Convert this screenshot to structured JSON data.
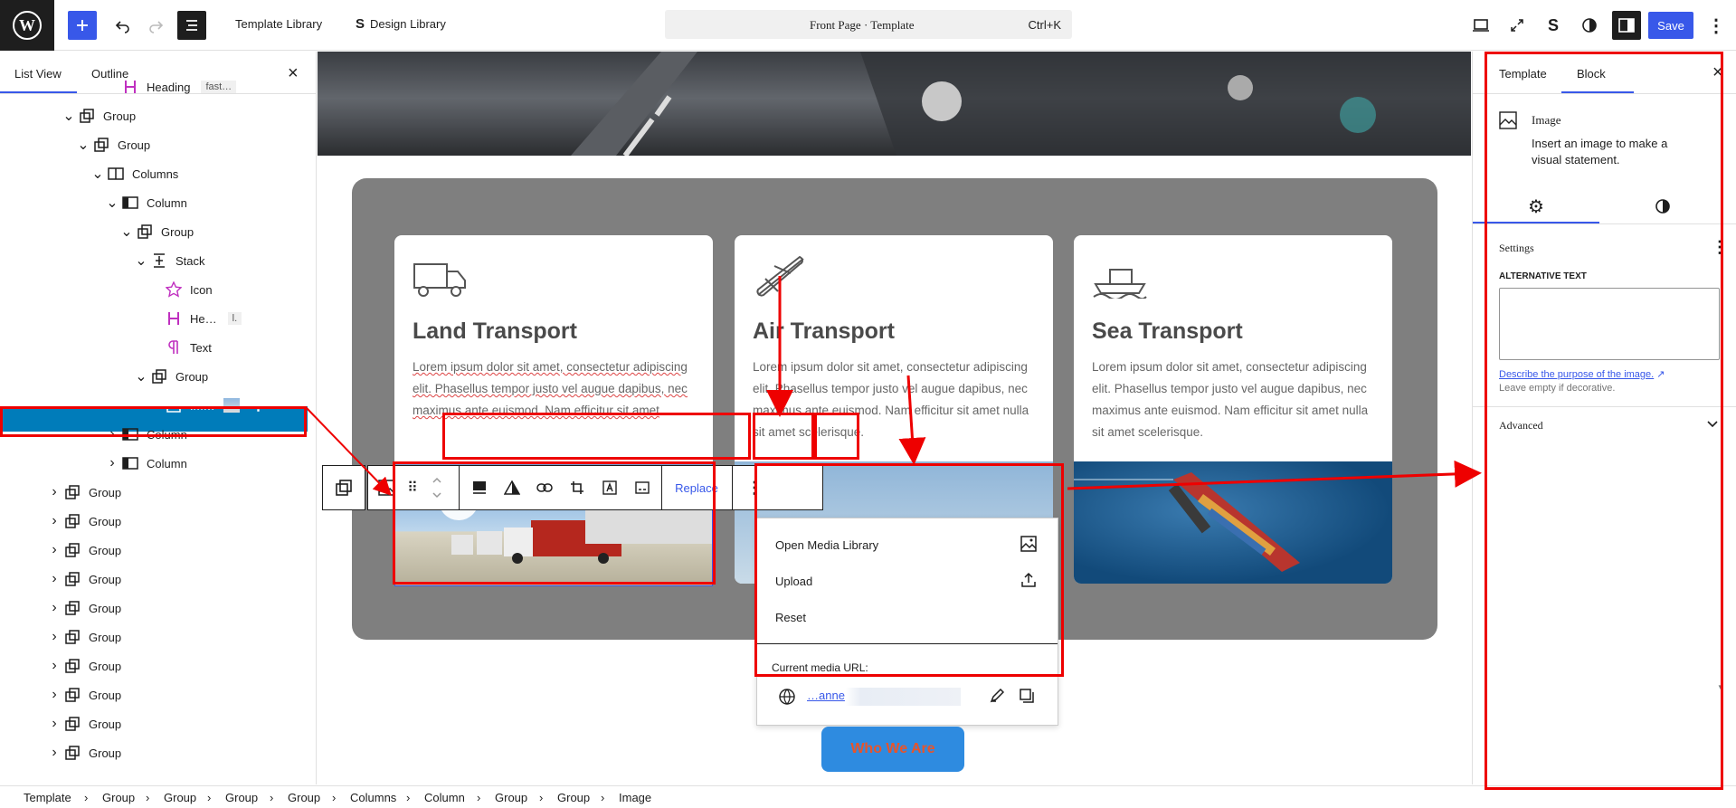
{
  "topbar": {
    "template_library": "Template Library",
    "design_library": "Design Library",
    "command_title": "Front Page · Template",
    "command_shortcut": "Ctrl+K",
    "save_label": "Save"
  },
  "left_panel": {
    "tabs": [
      "List View",
      "Outline"
    ],
    "rows": [
      {
        "label": "Heading",
        "badge": "fast…",
        "icon": "heading-icon"
      },
      {
        "label": "Group",
        "icon": "group-icon"
      },
      {
        "label": "Group",
        "icon": "group-icon"
      },
      {
        "label": "Columns",
        "icon": "columns-icon"
      },
      {
        "label": "Column",
        "icon": "column-icon"
      },
      {
        "label": "Group",
        "icon": "group-icon"
      },
      {
        "label": "Stack",
        "icon": "stack-icon"
      },
      {
        "label": "Icon",
        "icon": "star-icon"
      },
      {
        "label": "He…",
        "badge": "l.",
        "icon": "heading-icon"
      },
      {
        "label": "Text",
        "icon": "paragraph-icon"
      },
      {
        "label": "Group",
        "icon": "group-icon"
      },
      {
        "label": "Im…",
        "icon": "image-icon"
      },
      {
        "label": "Column",
        "icon": "column-icon"
      },
      {
        "label": "Column",
        "icon": "column-icon"
      },
      {
        "label": "Group",
        "icon": "group-icon"
      },
      {
        "label": "Group",
        "icon": "group-icon"
      },
      {
        "label": "Group",
        "icon": "group-icon"
      },
      {
        "label": "Group",
        "icon": "group-icon"
      },
      {
        "label": "Group",
        "icon": "group-icon"
      },
      {
        "label": "Group",
        "icon": "group-icon"
      },
      {
        "label": "Group",
        "icon": "group-icon"
      },
      {
        "label": "Group",
        "icon": "group-icon"
      },
      {
        "label": "Group",
        "icon": "group-icon"
      },
      {
        "label": "Group",
        "icon": "group-icon"
      }
    ]
  },
  "cards": [
    {
      "title": "Land Transport",
      "text": "Lorem ipsum dolor sit amet, consectetur adipiscing elit. Phasellus tempor justo vel augue dapibus, nec maximus ante euismod. Nam efficitur sit amet"
    },
    {
      "title": "Air Transport",
      "text": "Lorem ipsum dolor sit amet, consectetur adipiscing elit. Phasellus tempor justo vel augue dapibus, nec maximus ante euismod. Nam efficitur sit amet nulla sit amet scelerisque."
    },
    {
      "title": "Sea Transport",
      "text": "Lorem ipsum dolor sit amet, consectetur adipiscing elit. Phasellus tempor justo vel augue dapibus, nec maximus ante euismod. Nam efficitur sit amet nulla sit amet scelerisque."
    }
  ],
  "block_toolbar": {
    "replace_label": "Replace"
  },
  "replace_menu": {
    "open_media_library": "Open Media Library",
    "upload": "Upload",
    "reset": "Reset",
    "current_media_url_label": "Current media URL:",
    "url_text": "…anne"
  },
  "cta_button": "Who We Are",
  "right_panel": {
    "tabs": [
      "Template",
      "Block"
    ],
    "block_name": "Image",
    "block_description": "Insert an image to make a visual statement.",
    "settings_label": "Settings",
    "alt_text_label": "ALTERNATIVE TEXT",
    "describe_link": "Describe the purpose of the image.",
    "leave_empty": "Leave empty if decorative.",
    "advanced_label": "Advanced"
  },
  "breadcrumb": [
    "Template",
    "Group",
    "Group",
    "Group",
    "Group",
    "Columns",
    "Column",
    "Group",
    "Group",
    "Image"
  ],
  "colors": {
    "accent": "#3858e9",
    "selection": "#007cba",
    "annotation": "#e00000",
    "cta_text": "#e8542a"
  }
}
